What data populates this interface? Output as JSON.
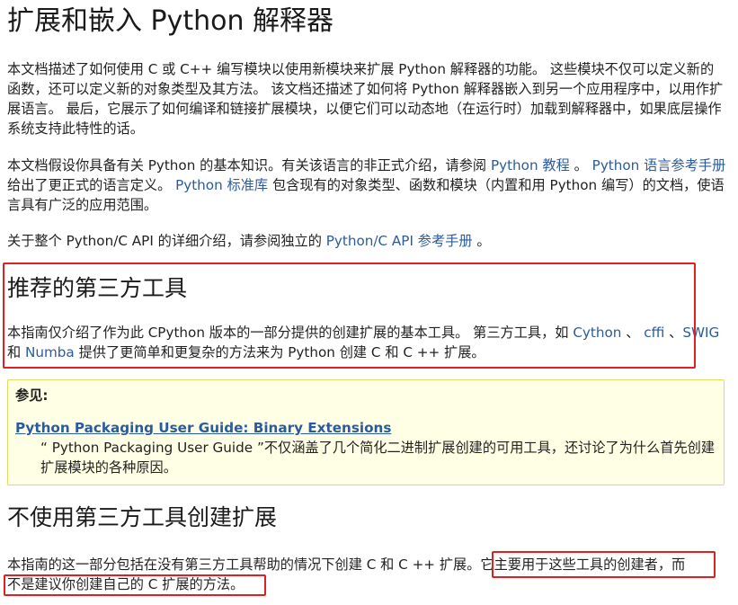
{
  "page_title": "扩展和嵌入 Python 解释器",
  "intro": {
    "p1": "本文档描述了如何使用 C 或 C++ 编写模块以使用新模块来扩展 Python 解释器的功能。 这些模块不仅可以定义新的函数，还可以定义新的对象类型及其方法。 该文档还描述了如何将 Python 解释器嵌入到另一个应用程序中，以用作扩展语言。 最后，它展示了如何编译和链接扩展模块，以便它们可以动态地（在运行时）加载到解释器中，如果底层操作系统支持此特性的话。",
    "p2_before": "本文档假设你具备有关 Python 的基本知识。有关该语言的非正式介绍，请参阅 ",
    "p2_link1": "Python 教程",
    "p2_mid1": " 。 ",
    "p2_link2": "Python 语言参考手册",
    "p2_mid2": " 给出了更正式的语言定义。 ",
    "p2_link3": "Python 标准库",
    "p2_after": " 包含现有的对象类型、函数和模块（内置和用 Python 编写）的文档，使语言具有广泛的应用范围。",
    "p3_before": "关于整个 Python/C API 的详细介绍，请参阅独立的 ",
    "p3_link": "Python/C API 参考手册",
    "p3_after": " 。"
  },
  "third_party": {
    "title": "推荐的第三方工具",
    "text_before": "本指南仅介绍了作为此 CPython 版本的一部分提供的创建扩展的基本工具。 第三方工具，如 ",
    "link_cython": "Cython",
    "sep1": " 、 ",
    "link_cffi": "cffi",
    "sep2": " 、",
    "link_swig": "SWIG",
    "sep3": " 和 ",
    "link_numba": "Numba",
    "text_after": " 提供了更简单和更复杂的方法来为 Python 创建 C 和 C ++ 扩展。"
  },
  "see_also": {
    "title": "参见:",
    "link": "Python Packaging User Guide: Binary Extensions",
    "desc": "“ Python Packaging User Guide ”不仅涵盖了几个简化二进制扩展创建的可用工具，还讨论了为什么首先创建扩展模块的各种原因。"
  },
  "no_third_party": {
    "title": "不使用第三方工具创建扩展",
    "text_line1": "本指南的这一部分包括在没有第三方工具帮助的情况下创建 C 和 C ++ 扩展。它主要用于这些工具的创建者，而",
    "text_line2": "不是建议你创建自己的 C 扩展的方法。"
  },
  "colors": {
    "link": "#2b5b9e",
    "highlight_box": "#e02020",
    "seealso_bg": "#ffffe5",
    "seealso_border": "#dddd66"
  }
}
